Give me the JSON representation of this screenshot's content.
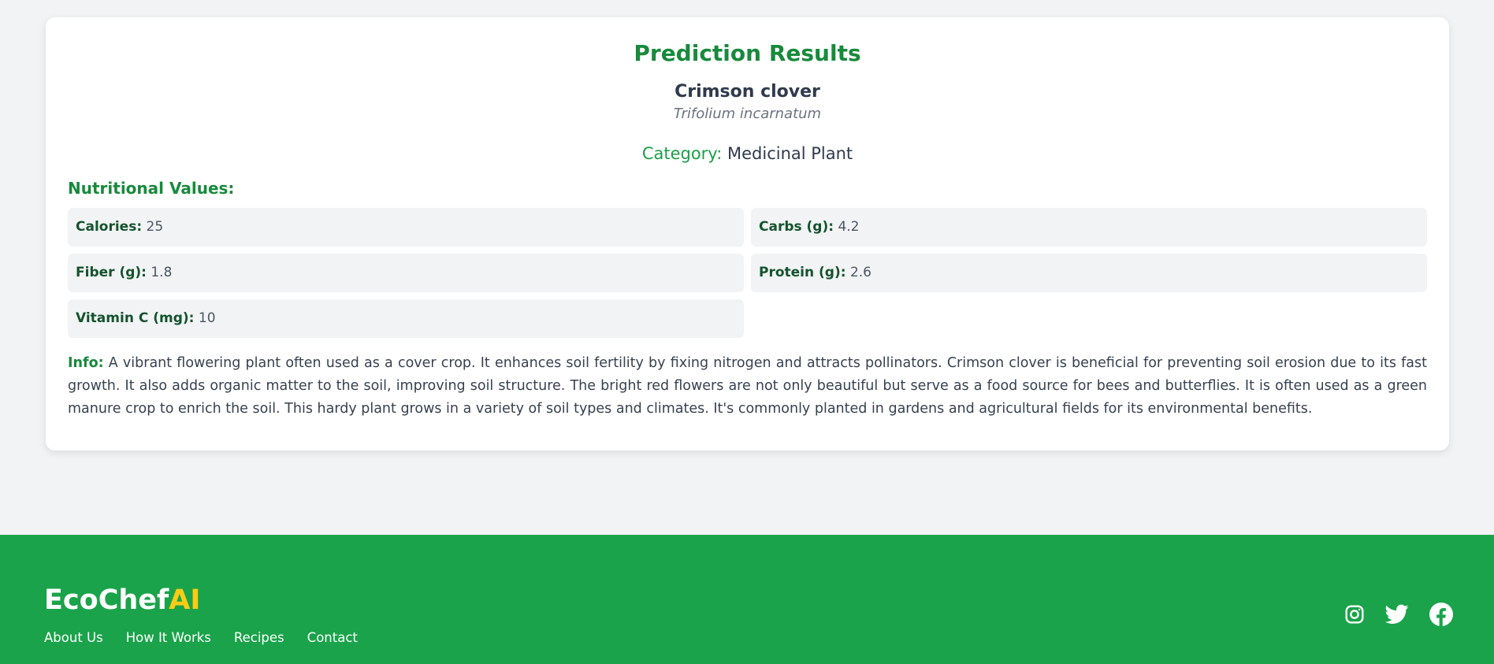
{
  "results": {
    "title": "Prediction Results",
    "plant_name": "Crimson clover",
    "scientific_name": "Trifolium incarnatum",
    "category_label": "Category:",
    "category_value": "Medicinal Plant",
    "nutrition_title": "Nutritional Values:",
    "nutrition": [
      {
        "label": "Calories:",
        "value": "25"
      },
      {
        "label": "Carbs (g):",
        "value": "4.2"
      },
      {
        "label": "Fiber (g):",
        "value": "1.8"
      },
      {
        "label": "Protein (g):",
        "value": "2.6"
      },
      {
        "label": "Vitamin C (mg):",
        "value": "10"
      }
    ],
    "info_label": "Info:",
    "info_text": "A vibrant flowering plant often used as a cover crop. It enhances soil fertility by fixing nitrogen and attracts pollinators. Crimson clover is beneficial for preventing soil erosion due to its fast growth. It also adds organic matter to the soil, improving soil structure. The bright red flowers are not only beautiful but serve as a food source for bees and butterflies. It is often used as a green manure crop to enrich the soil. This hardy plant grows in a variety of soil types and climates. It's commonly planted in gardens and agricultural fields for its environmental benefits."
  },
  "footer": {
    "brand_main": "EcoChef",
    "brand_accent": "AI",
    "links": [
      "About Us",
      "How It Works",
      "Recipes",
      "Contact"
    ],
    "social_icons": [
      "instagram-icon",
      "twitter-icon",
      "facebook-icon"
    ]
  },
  "colors": {
    "accent_green": "#178a3c",
    "footer_green": "#1aa34a",
    "brand_yellow": "#facc15",
    "page_background": "#f2f3f5"
  }
}
